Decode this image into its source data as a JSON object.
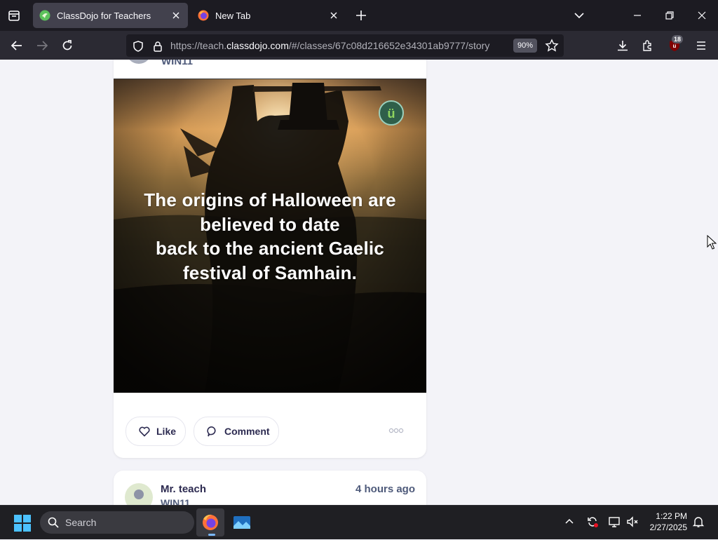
{
  "browser": {
    "tabs": [
      {
        "label": "ClassDojo for Teachers",
        "active": true
      },
      {
        "label": "New Tab",
        "active": false
      }
    ],
    "url": {
      "prefix": "https://teach.",
      "host": "classdojo.com",
      "path": "/#/classes/67c08d216652e34301ab9777/story"
    },
    "zoom": "90%",
    "extension_badge": "18"
  },
  "feed": {
    "post1": {
      "class_name": "WIN11",
      "story_lines": [
        "The origins of Halloween are",
        "believed to date",
        "back to the ancient Gaelic",
        "festival of Samhain."
      ],
      "like_label": "Like",
      "comment_label": "Comment"
    },
    "post2": {
      "teacher": "Mr. teach",
      "class_name": "WIN11",
      "time": "4 hours ago"
    }
  },
  "taskbar": {
    "search_placeholder": "Search",
    "time": "1:22 PM",
    "date": "2/27/2025"
  },
  "colors": {
    "chrome_dark": "#1c1b22",
    "toolbar": "#2b2a33",
    "page_bg": "#f3f3f8",
    "text_dark": "#2c2a50",
    "text_muted": "#4e5a7a"
  }
}
